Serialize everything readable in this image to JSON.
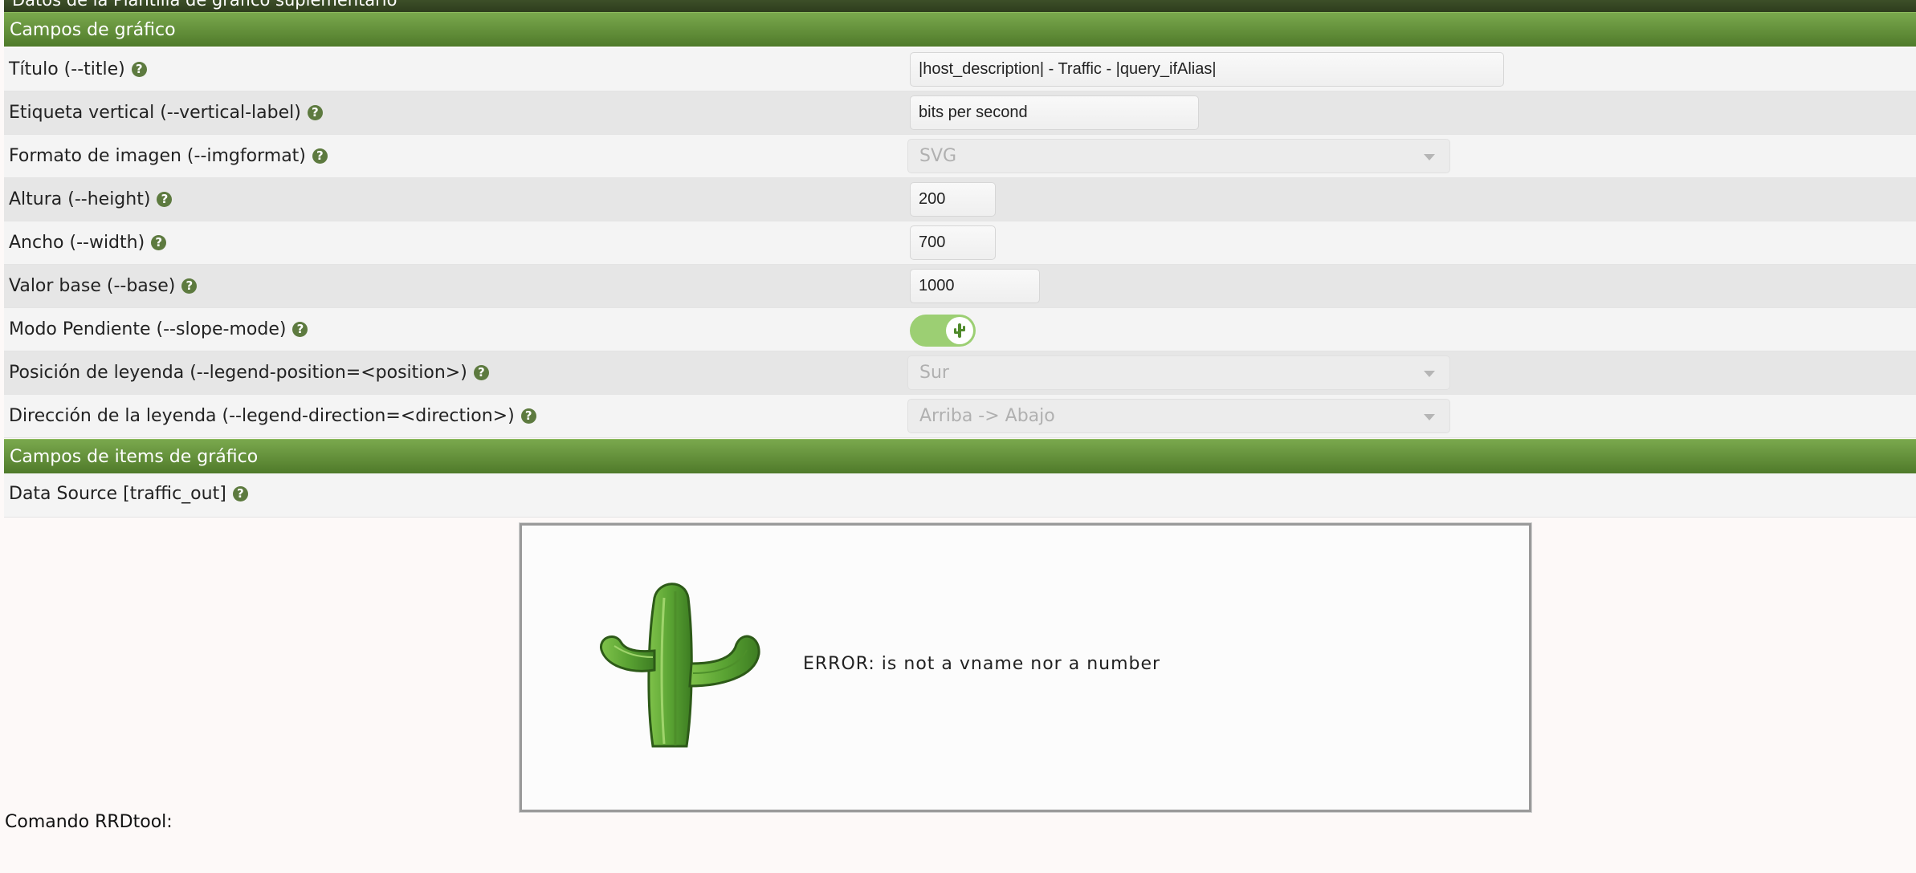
{
  "header": {
    "title": "Datos de la Plantilla de gráfico suplementario"
  },
  "graph_fields": {
    "section_title": "Campos de gráfico",
    "title": {
      "label": "Título (--title)",
      "value": "|host_description| - Traffic - |query_ifAlias|"
    },
    "vertical_label": {
      "label": "Etiqueta vertical (--vertical-label)",
      "value": "bits per second"
    },
    "image_format": {
      "label": "Formato de imagen (--imgformat)",
      "value": "SVG"
    },
    "height": {
      "label": "Altura (--height)",
      "value": "200"
    },
    "width": {
      "label": "Ancho (--width)",
      "value": "700"
    },
    "base_value": {
      "label": "Valor base (--base)",
      "value": "1000"
    },
    "slope_mode": {
      "label": "Modo Pendiente (--slope-mode)",
      "on": true
    },
    "legend_position": {
      "label": "Posición de leyenda (--legend-position=<position>)",
      "value": "Sur"
    },
    "legend_direction": {
      "label": "Dirección de la leyenda (--legend-direction=<direction>)",
      "value": "Arriba -> Abajo"
    }
  },
  "graph_item_fields": {
    "section_title": "Campos de items de gráfico",
    "data_source": {
      "label": "Data Source [traffic_out]"
    }
  },
  "preview": {
    "error_text": "ERROR:  is not a vname nor a number"
  },
  "rrdtool": {
    "label": "Comando RRDtool:"
  },
  "icons": {
    "help": "help-circle-icon",
    "toggle": "cactus-icon",
    "mascot": "cactus-mascot"
  },
  "colors": {
    "section": "#5f8a36",
    "toggle_on": "#9ccf73",
    "help": "#5d7a3f"
  }
}
